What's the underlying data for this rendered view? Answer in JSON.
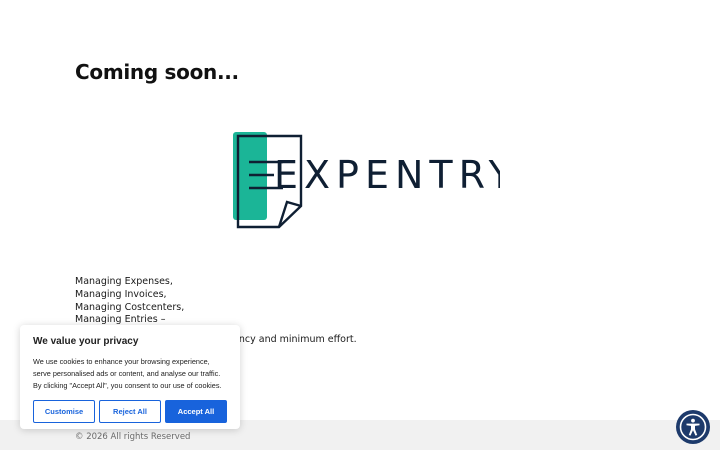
{
  "page": {
    "heading": "Coming soon...",
    "logo_text": "EXPENTRY",
    "features": [
      "Managing Expenses,",
      "Managing Invoices,",
      "Managing Costcenters,",
      "Managing Entries –"
    ],
    "tagline": "all together, with maximum efficiency and minimum effort."
  },
  "footer": {
    "copyright": "© 2026 All rights Reserved"
  },
  "cookie_banner": {
    "title": "We value your privacy",
    "text": "We use cookies to enhance your browsing experience, serve personalised ads or content, and analyse our traffic. By clicking \"Accept All\", you consent to our use of cookies.",
    "customise_label": "Customise",
    "reject_label": "Reject All",
    "accept_label": "Accept All"
  },
  "icons": {
    "logo_mark": "document-fold-icon",
    "accessibility": "accessibility-icon"
  },
  "colors": {
    "brand_teal": "#1bb597",
    "brand_navy": "#0f1f33",
    "button_blue": "#1863dc",
    "accessibility_bg": "#1d3a6b",
    "footer_bg": "#f1f1f1"
  }
}
